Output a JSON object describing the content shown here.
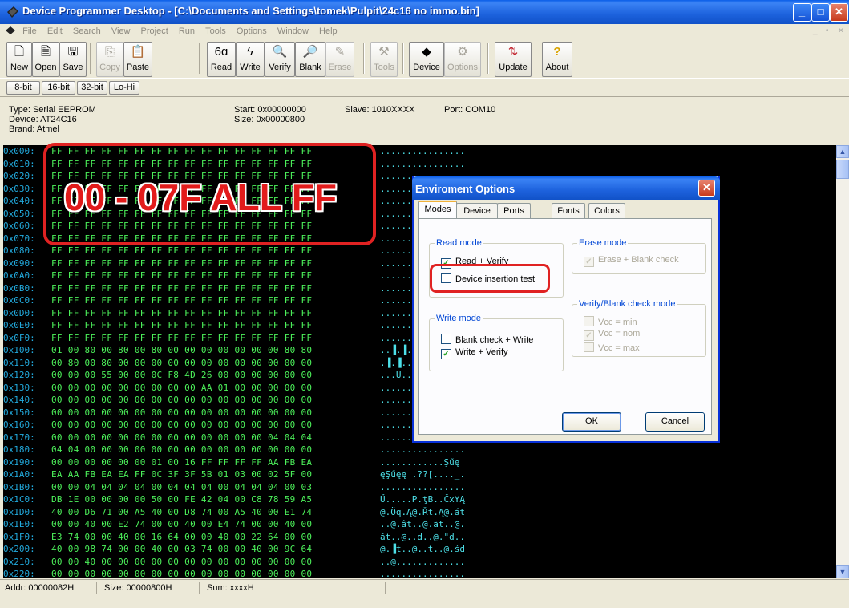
{
  "window": {
    "title": "Device Programmer Desktop - [C:\\Documents and Settings\\tomek\\Pulpit\\24c16 no immo.bin]",
    "min": "_",
    "max": "□",
    "close": "✕"
  },
  "menu": [
    "File",
    "Edit",
    "Search",
    "View",
    "Project",
    "Run",
    "Tools",
    "Options",
    "Window",
    "Help"
  ],
  "toolbar": {
    "new": "New",
    "open": "Open",
    "save": "Save",
    "copy": "Copy",
    "paste": "Paste",
    "read": "Read",
    "write": "Write",
    "verify": "Verify",
    "blank": "Blank",
    "erase": "Erase",
    "tools": "Tools",
    "device": "Device",
    "options": "Options",
    "update": "Update",
    "about": "About"
  },
  "bitbar": {
    "b8": "8-bit",
    "b16": "16-bit",
    "b32": "32-bit",
    "lohi": "Lo-Hi"
  },
  "info": {
    "type": "Type: Serial EEPROM",
    "device": "Device: AT24C16",
    "brand": "Brand: Atmel",
    "start": "Start: 0x00000000",
    "size": "Size: 0x00000800",
    "slave": "Slave: 1010XXXX",
    "port": "Port: COM10"
  },
  "hex_rows": [
    {
      "a": "0x000:",
      "b": "FF FF FF FF FF FF FF FF FF FF FF FF FF FF FF FF",
      "c": "................"
    },
    {
      "a": "0x010:",
      "b": "FF FF FF FF FF FF FF FF FF FF FF FF FF FF FF FF",
      "c": "................"
    },
    {
      "a": "0x020:",
      "b": "FF FF FF FF FF FF FF FF FF FF FF FF FF FF FF FF",
      "c": "................"
    },
    {
      "a": "0x030:",
      "b": "FF FF FF FF FF FF FF FF FF FF FF FF FF FF FF FF",
      "c": "................"
    },
    {
      "a": "0x040:",
      "b": "FF FF FF FF FF FF FF FF FF FF FF FF FF FF FF FF",
      "c": "................"
    },
    {
      "a": "0x050:",
      "b": "FF FF FF FF FF FF FF FF FF FF FF FF FF FF FF FF",
      "c": "................"
    },
    {
      "a": "0x060:",
      "b": "FF FF FF FF FF FF FF FF FF FF FF FF FF FF FF FF",
      "c": "................"
    },
    {
      "a": "0x070:",
      "b": "FF FF FF FF FF FF FF FF FF FF FF FF FF FF FF FF",
      "c": "................"
    },
    {
      "a": "0x080:",
      "b": "FF FF FF FF FF FF FF FF FF FF FF FF FF FF FF FF",
      "c": "................"
    },
    {
      "a": "0x090:",
      "b": "FF FF FF FF FF FF FF FF FF FF FF FF FF FF FF FF",
      "c": "................"
    },
    {
      "a": "0x0A0:",
      "b": "FF FF FF FF FF FF FF FF FF FF FF FF FF FF FF FF",
      "c": "................"
    },
    {
      "a": "0x0B0:",
      "b": "FF FF FF FF FF FF FF FF FF FF FF FF FF FF FF FF",
      "c": "................"
    },
    {
      "a": "0x0C0:",
      "b": "FF FF FF FF FF FF FF FF FF FF FF FF FF FF FF FF",
      "c": "................"
    },
    {
      "a": "0x0D0:",
      "b": "FF FF FF FF FF FF FF FF FF FF FF FF FF FF FF FF",
      "c": "................"
    },
    {
      "a": "0x0E0:",
      "b": "FF FF FF FF FF FF FF FF FF FF FF FF FF FF FF FF",
      "c": "................"
    },
    {
      "a": "0x0F0:",
      "b": "FF FF FF FF FF FF FF FF FF FF FF FF FF FF FF FF",
      "c": "................"
    },
    {
      "a": "0x100:",
      "b": "01 00 80 00 80 00 80 00 00 00 00 00 00 00 80 80",
      "c": "..▐.▐.▐......▐▐"
    },
    {
      "a": "0x110:",
      "b": "00 80 00 80 00 00 00 00 00 00 00 00 00 00 00 00",
      "c": ".▐.▐............"
    },
    {
      "a": "0x120:",
      "b": "00 00 00 55 00 00 0C F8 4D 26 00 00 00 00 00 00",
      "c": "...U..........."
    },
    {
      "a": "0x130:",
      "b": "00 00 00 00 00 00 00 00 00 AA 01 00 00 00 00 00",
      "c": "................"
    },
    {
      "a": "0x140:",
      "b": "00 00 00 00 00 00 00 00 00 00 00 00 00 00 00 00",
      "c": "................"
    },
    {
      "a": "0x150:",
      "b": "00 00 00 00 00 00 00 00 00 00 00 00 00 00 00 00",
      "c": "................"
    },
    {
      "a": "0x160:",
      "b": "00 00 00 00 00 00 00 00 00 00 00 00 00 00 00 00",
      "c": "................"
    },
    {
      "a": "0x170:",
      "b": "00 00 00 00 00 00 00 00 00 00 00 00 00 04 04 04",
      "c": "................"
    },
    {
      "a": "0x180:",
      "b": "04 04 00 00 00 00 00 00 00 00 00 00 00 00 00 00",
      "c": "................"
    },
    {
      "a": "0x190:",
      "b": "00 00 00 00 00 00 01 00 16 FF FF FF FF AA FB EA",
      "c": "............Şűę"
    },
    {
      "a": "0x1A0:",
      "b": "EA AA FB EA EA FF 0C 3F 3F 5B 01 03 00 02 5F 00",
      "c": "ęŞűęę .??[...._."
    },
    {
      "a": "0x1B0:",
      "b": "00 00 04 04 04 04 00 04 04 04 00 04 04 04 00 03",
      "c": "................"
    },
    {
      "a": "0x1C0:",
      "b": "DB 1E 00 00 00 00 50 00 FE 42 04 00 C8 78 59 A5",
      "c": "Ű.....P.ţB..ČxYĄ"
    },
    {
      "a": "0x1D0:",
      "b": "40 00 D6 71 00 A5 40 00 D8 74 00 A5 40 00 E1 74",
      "c": "@.Öq.Ą@.Řt.Ą@.át"
    },
    {
      "a": "0x1E0:",
      "b": "00 00 40 00 E2 74 00 00 40 00 E4 74 00 00 40 00",
      "c": "..@.ât..@.ät..@."
    },
    {
      "a": "0x1F0:",
      "b": "E3 74 00 00 40 00 16 64 00 00 40 00 22 64 00 00",
      "c": "ăt..@..d..@.\"d.."
    },
    {
      "a": "0x200:",
      "b": "40 00 98 74 00 00 40 00 03 74 00 00 40 00 9C 64",
      "c": "@.▐t..@..t..@.śd"
    },
    {
      "a": "0x210:",
      "b": "00 00 40 00 00 00 00 00 00 00 00 00 00 00 00 00",
      "c": "..@............."
    },
    {
      "a": "0x220:",
      "b": "00 00 00 00 00 00 00 00 00 00 00 00 00 00 00 00",
      "c": "................"
    }
  ],
  "annotation": "00 - 07F ALL FF",
  "dialog": {
    "title": "Enviroment Options",
    "tabs": [
      "Modes",
      "Device",
      "Ports",
      "Fonts",
      "Colors"
    ],
    "read_mode": {
      "label": "Read mode",
      "read_verify": "Read + Verify",
      "insertion_test": "Device insertion test"
    },
    "erase_mode": {
      "label": "Erase mode",
      "erase_blank": "Erase + Blank check"
    },
    "write_mode": {
      "label": "Write mode",
      "blank_write": "Blank check + Write",
      "write_verify": "Write + Verify"
    },
    "verify_mode": {
      "label": "Verify/Blank check mode",
      "vmin": "Vcc = min",
      "vnom": "Vcc = nom",
      "vmax": "Vcc = max"
    },
    "ok": "OK",
    "cancel": "Cancel"
  },
  "status": {
    "addr": "Addr: 00000082H",
    "size": "Size: 00000800H",
    "sum": "Sum: xxxxH"
  },
  "colors": {
    "hex_bytes": "#4cf05a",
    "hex_addr": "#22aadd",
    "hex_ascii": "#4de0e8",
    "annotation": "#e21b1b",
    "title_bar": "#1d62dd"
  }
}
